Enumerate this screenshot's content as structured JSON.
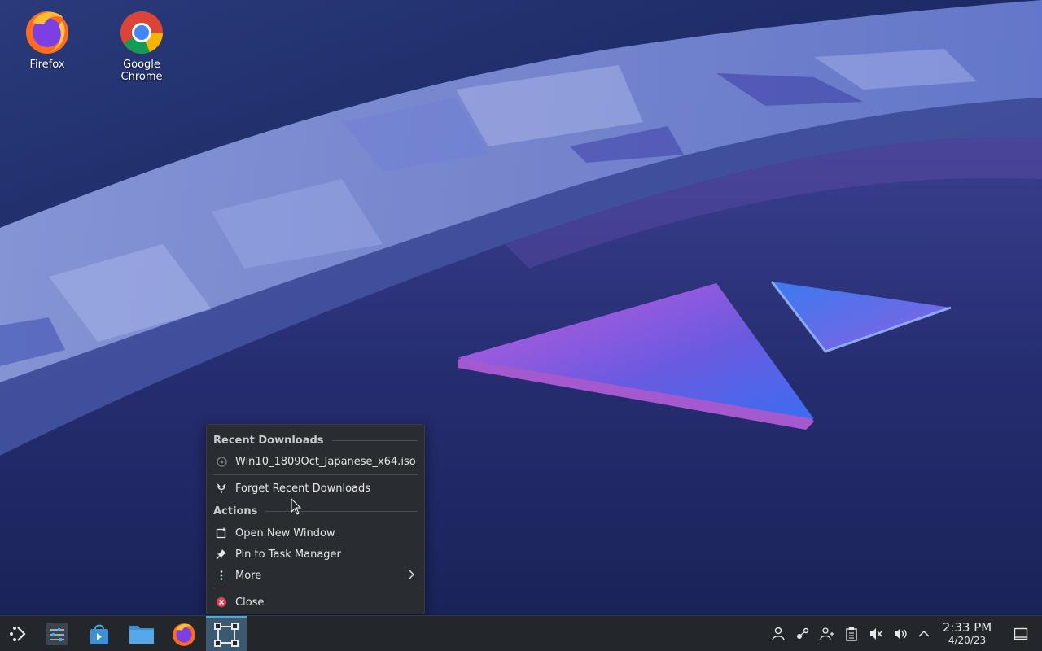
{
  "desktop": {
    "icons": [
      {
        "label": "Firefox",
        "icon": "firefox-icon"
      },
      {
        "label": "Google Chrome",
        "icon": "chrome-icon"
      }
    ]
  },
  "context_menu": {
    "recent_section": "Recent Downloads",
    "recent_item": "Win10_1809Oct_Japanese_x64.iso",
    "forget_label": "Forget Recent Downloads",
    "actions_section": "Actions",
    "open_window_label": "Open New Window",
    "pin_label": "Pin to Task Manager",
    "more_label": "More",
    "close_label": "Close"
  },
  "taskbar": {
    "launchers": [
      "application-launcher-icon",
      "system-settings-icon",
      "discover-store-icon",
      "file-manager-icon",
      "firefox-icon",
      "window-overview-icon"
    ],
    "tray": [
      "user-icon",
      "connect-icon",
      "accounts-icon",
      "clipboard-icon",
      "mute-icon",
      "volume-icon",
      "expand-tray-icon"
    ],
    "clock": {
      "time": "2:33 PM",
      "date": "4/20/23"
    },
    "accent": "#3daee9"
  }
}
